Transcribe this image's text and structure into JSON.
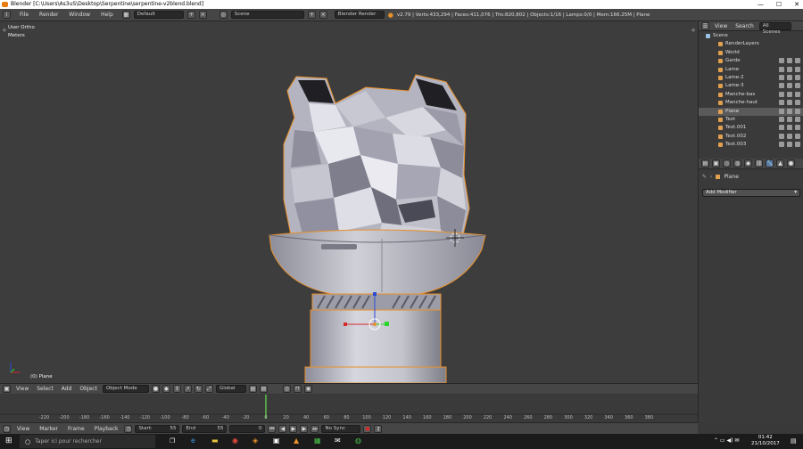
{
  "window": {
    "title": "Blender [C:\\Users\\As3uS\\Desktop\\Serpentine\\serpentine-v2blend.blend]",
    "minimize": "—",
    "maximize": "☐",
    "close": "✕"
  },
  "topbar": {
    "menus": [
      "File",
      "Render",
      "Window",
      "Help"
    ],
    "layout": "Default",
    "scene": "Scene",
    "engine": "Blender Render",
    "stats": "v2.79 | Verts:433,294 | Faces:411,076 | Tris:820,802 | Objects:1/16 | Lamps:0/0 | Mem:166.25M | Plane"
  },
  "viewport": {
    "view_name": "User Ortho",
    "units": "Meters",
    "object_label": "(0) Plane"
  },
  "view3d_header": {
    "menus": [
      "View",
      "Select",
      "Add",
      "Object"
    ],
    "mode": "Object Mode",
    "orientation": "Global"
  },
  "timeline": {
    "ticks": [
      "-220",
      "-200",
      "-180",
      "-160",
      "-140",
      "-120",
      "-100",
      "-80",
      "-60",
      "-40",
      "-20",
      "0",
      "20",
      "40",
      "60",
      "80",
      "100",
      "120",
      "140",
      "160",
      "180",
      "200",
      "220",
      "240",
      "260",
      "280",
      "300",
      "320",
      "340",
      "360",
      "380"
    ],
    "menus": [
      "View",
      "Marker",
      "Frame",
      "Playback"
    ],
    "start_label": "Start:",
    "start_value": "55",
    "end_label": "End",
    "end_value": "55",
    "current_frame": "0",
    "sync": "No Sync"
  },
  "outliner": {
    "tabs": [
      "View",
      "Search",
      "All Scenes"
    ],
    "items": [
      {
        "name": "Scene",
        "indent": 0
      },
      {
        "name": "RenderLayers",
        "indent": 1
      },
      {
        "name": "World",
        "indent": 1
      },
      {
        "name": "Garde",
        "indent": 1
      },
      {
        "name": "Lame",
        "indent": 1
      },
      {
        "name": "Lame-2",
        "indent": 1
      },
      {
        "name": "Lame-3",
        "indent": 1
      },
      {
        "name": "Manche-bas",
        "indent": 1
      },
      {
        "name": "Manche-haut",
        "indent": 1
      },
      {
        "name": "Plane",
        "indent": 1
      },
      {
        "name": "Text",
        "indent": 1
      },
      {
        "name": "Text.001",
        "indent": 1
      },
      {
        "name": "Text.002",
        "indent": 1
      },
      {
        "name": "Text.003",
        "indent": 1
      }
    ]
  },
  "properties": {
    "object_name": "Plane",
    "add_modifier": "Add Modifier"
  },
  "taskbar": {
    "search_placeholder": "Taper ici pour rechercher",
    "time": "01:42",
    "date": "21/10/2017"
  },
  "colors": {
    "selection_outline": "#e8902a",
    "axis_x": "#d42a2a",
    "axis_y": "#2ad42a",
    "axis_z": "#2a4ad4",
    "playhead": "#5fc24a"
  }
}
